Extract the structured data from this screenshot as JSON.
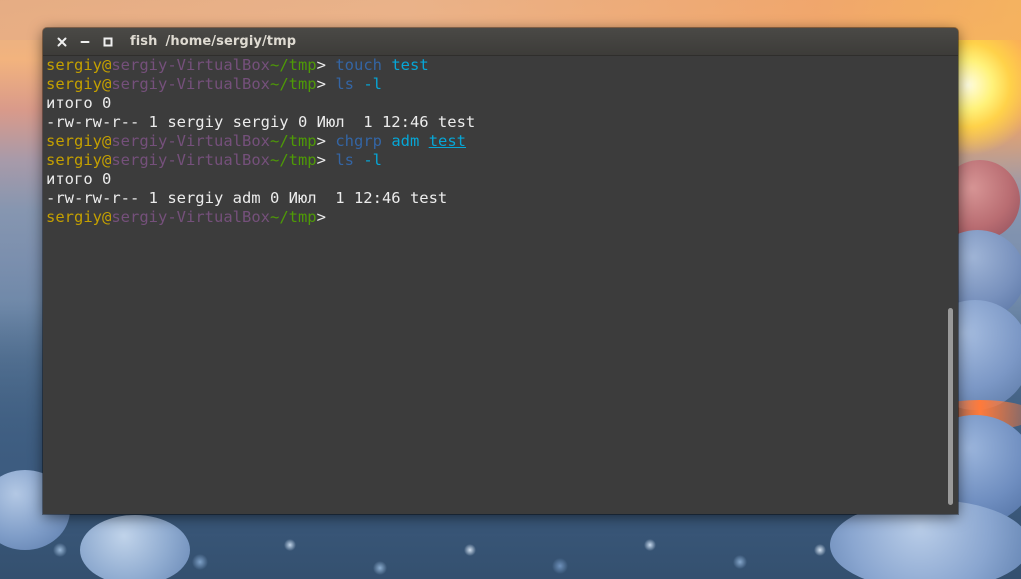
{
  "window": {
    "app_name": "fish",
    "path": "/home/sergiy/tmp",
    "controls": {
      "close": "close-icon",
      "minimize": "minimize-icon",
      "maximize": "maximize-icon"
    }
  },
  "colors": {
    "user": "#c4a000",
    "host": "#75507b",
    "cwd": "#4e9a06",
    "command": "#3465a4",
    "argument": "#06a6d6",
    "output": "#ececec",
    "terminal_background": "#3c3c3c"
  },
  "terminal": {
    "lines": [
      {
        "type": "prompt",
        "user": "sergiy",
        "at": "@",
        "host": "sergiy-VirtualBox",
        "cwd": "~/tmp",
        "arrow": "> ",
        "command": "touch",
        "args": [
          " ",
          "test"
        ],
        "path_arg": ""
      },
      {
        "type": "prompt",
        "user": "sergiy",
        "at": "@",
        "host": "sergiy-VirtualBox",
        "cwd": "~/tmp",
        "arrow": "> ",
        "command": "ls",
        "args": [
          " ",
          "-l"
        ],
        "path_arg": ""
      },
      {
        "type": "output",
        "text": "итого 0"
      },
      {
        "type": "output",
        "text": "-rw-rw-r-- 1 sergiy sergiy 0 Июл  1 12:46 test"
      },
      {
        "type": "prompt",
        "user": "sergiy",
        "at": "@",
        "host": "sergiy-VirtualBox",
        "cwd": "~/tmp",
        "arrow": "> ",
        "command": "chgrp",
        "args": [
          " ",
          "adm",
          " "
        ],
        "path_arg": "test"
      },
      {
        "type": "prompt",
        "user": "sergiy",
        "at": "@",
        "host": "sergiy-VirtualBox",
        "cwd": "~/tmp",
        "arrow": "> ",
        "command": "ls",
        "args": [
          " ",
          "-l"
        ],
        "path_arg": ""
      },
      {
        "type": "output",
        "text": "итого 0"
      },
      {
        "type": "output",
        "text": "-rw-rw-r-- 1 sergiy adm 0 Июл  1 12:46 test"
      },
      {
        "type": "prompt",
        "user": "sergiy",
        "at": "@",
        "host": "sergiy-VirtualBox",
        "cwd": "~/tmp",
        "arrow": "> ",
        "command": "",
        "args": [],
        "path_arg": ""
      }
    ]
  },
  "scrollbar": {
    "thumb_start_fraction": 0.55,
    "thumb_end_fraction": 0.98
  }
}
